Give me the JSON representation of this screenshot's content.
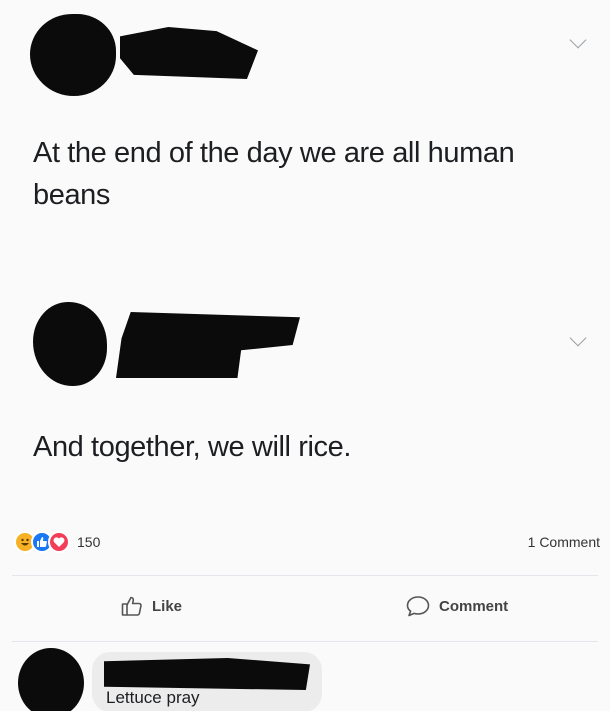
{
  "post": {
    "text": "At the end of the day we are all human beans"
  },
  "reply": {
    "text": "And together, we will rice."
  },
  "stats": {
    "reactions_count": "150",
    "comments_label": "1 Comment"
  },
  "actions": {
    "like_label": "Like",
    "comment_label": "Comment"
  },
  "comment": {
    "text": "Lettuce pray"
  },
  "icons": {
    "chevron": "chevron-down-icon",
    "haha": "haha-reaction-icon",
    "like": "like-reaction-icon",
    "love": "love-reaction-icon",
    "like_action": "thumbs-up-icon",
    "comment_action": "speech-bubble-icon"
  },
  "colors": {
    "like_blue": "#1877f2",
    "love_red": "#f33e58",
    "haha_yellow": "#f7b125"
  }
}
